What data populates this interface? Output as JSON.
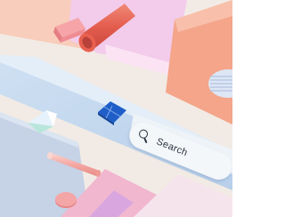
{
  "search": {
    "placeholder": "Search",
    "icon": "search-icon"
  },
  "colors": {
    "background": "#f3ece6",
    "accent_blue": "#2f6fd0",
    "strip_blue": "#c9dbef",
    "peach": "#f5b49a",
    "coral": "#e98a6c",
    "lilac": "#e2b8dc",
    "pink": "#f2a6a6"
  }
}
